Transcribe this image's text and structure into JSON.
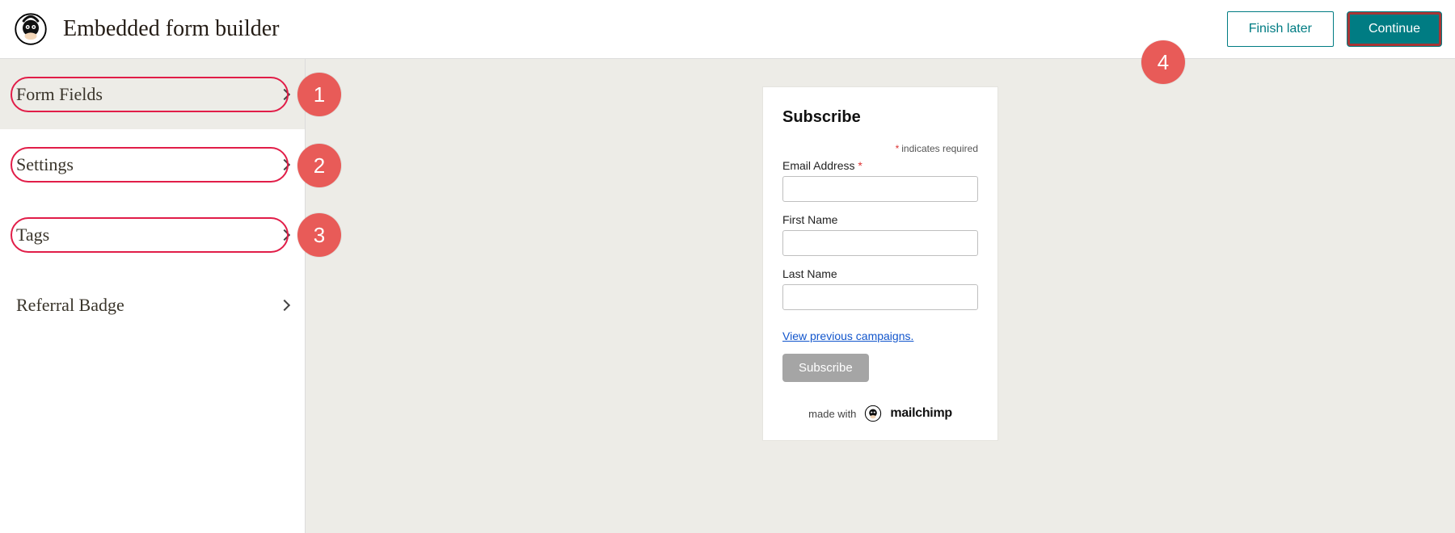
{
  "header": {
    "title": "Embedded form builder",
    "finish_label": "Finish later",
    "continue_label": "Continue"
  },
  "sidebar": {
    "items": [
      {
        "label": "Form Fields",
        "highlighted": true,
        "active": true
      },
      {
        "label": "Settings",
        "highlighted": true,
        "active": false
      },
      {
        "label": "Tags",
        "highlighted": true,
        "active": false
      },
      {
        "label": "Referral Badge",
        "highlighted": false,
        "active": false
      }
    ]
  },
  "annotations": {
    "1": "1",
    "2": "2",
    "3": "3",
    "4": "4"
  },
  "form": {
    "title": "Subscribe",
    "required_note": "indicates required",
    "fields": {
      "email": {
        "label": "Email Address",
        "required": true,
        "value": ""
      },
      "first": {
        "label": "First Name",
        "required": false,
        "value": ""
      },
      "last": {
        "label": "Last Name",
        "required": false,
        "value": ""
      }
    },
    "prev_campaigns_link": "View previous campaigns.",
    "submit_label": "Subscribe",
    "made_with": "made with",
    "brand": "mailchimp"
  }
}
